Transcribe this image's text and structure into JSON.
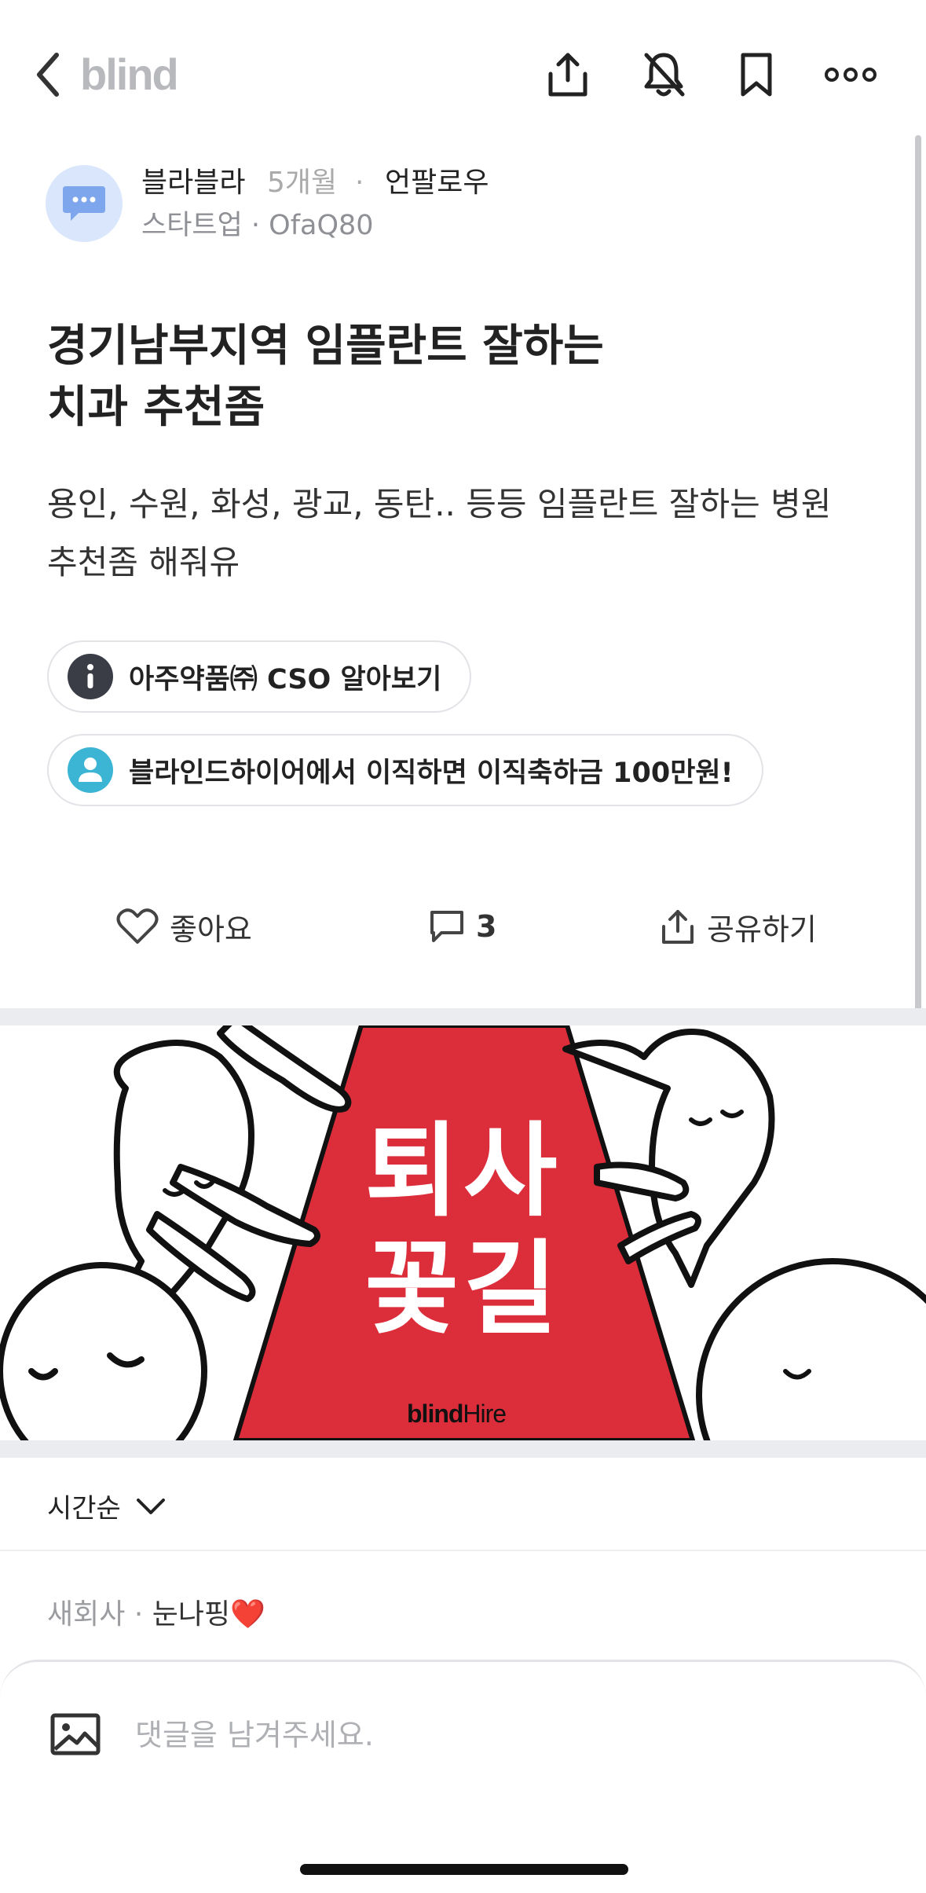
{
  "nav": {
    "logo": "blind"
  },
  "author": {
    "name": "블라블라",
    "time": "5개월",
    "separator": "·",
    "follow_label": "언팔로우",
    "meta": "스타트업 · OfaQ80"
  },
  "post": {
    "title_line1": "경기남부지역 임플란트 잘하는",
    "title_line2": "치과 추천좀",
    "body_line1": "용인, 수원, 화성, 광교, 동탄.. 등등 임플란트 잘하는 병원",
    "body_line2": "추천좀 해줘유"
  },
  "pills": [
    {
      "label": "아주약품㈜ CSO 알아보기",
      "icon": "info-icon",
      "color": "#3a3d45"
    },
    {
      "label": "블라인드하이어에서 이직하면 이직축하금 100만원!",
      "icon": "person-icon",
      "color": "#3bb5d3"
    }
  ],
  "actions": {
    "like_label": "좋아요",
    "comment_count": "3",
    "share_label": "공유하기"
  },
  "banner": {
    "headline_line1": "퇴사",
    "headline_line2": "꽃길",
    "brand": "blind",
    "brand_suffix": "Hire",
    "carpet_color": "#dc2d3b"
  },
  "sort": {
    "label": "시간순"
  },
  "comment_preview": {
    "company": "새회사",
    "separator": " · ",
    "nickname": "눈나핑",
    "emoji": "❤️"
  },
  "composer": {
    "placeholder": "댓글을 남겨주세요."
  }
}
